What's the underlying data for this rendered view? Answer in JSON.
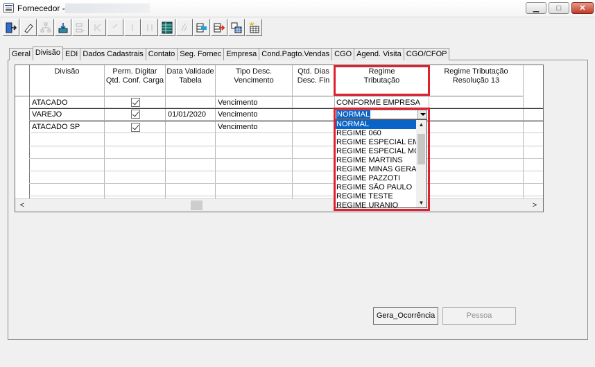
{
  "window": {
    "title": "Fornecedor -",
    "minimize_label": "▁",
    "maximize_label": "□",
    "close_label": "✕"
  },
  "toolbar": {
    "buttons": [
      "exit-icon",
      "edit-icon",
      "tree-icon",
      "save-download-icon",
      "cut-icon",
      "first-icon",
      "prev-icon",
      "next-icon",
      "last-icon",
      "grid-icon",
      "pencil-icon",
      "export-icon",
      "import-icon",
      "table-icon",
      "refresh-table-icon"
    ]
  },
  "tabs": [
    "Geral",
    "Divisão",
    "EDI",
    "Dados Cadastrais",
    "Contato",
    "Seg. Fornec",
    "Empresa",
    "Cond.Pagto.Vendas",
    "CGO",
    "Agend. Visita",
    "CGO/CFOP"
  ],
  "active_tab": "Divisão",
  "grid": {
    "headers": {
      "divisao": "Divisão",
      "perm_digitar_1": "Perm. Digitar",
      "perm_digitar_2": "Qtd. Conf. Carga",
      "data_validade_1": "Data Validade",
      "data_validade_2": "Tabela",
      "tipo_desc_1": "Tipo Desc.",
      "tipo_desc_2": "Vencimento",
      "qtd_dias_1": "Qtd. Dias",
      "qtd_dias_2": "Desc. Fin",
      "regime_1": "Regime",
      "regime_2": "Tributação",
      "regime_res_1": "Regime Tributação",
      "regime_res_2": "Resolução 13"
    },
    "rows": [
      {
        "divisao": "ATACADO",
        "perm": true,
        "data": "",
        "tipo": "Vencimento",
        "qtd": "",
        "regime": "CONFORME EMPRESA"
      },
      {
        "divisao": "VAREJO",
        "perm": true,
        "data": "01/01/2020",
        "tipo": "Vencimento",
        "qtd": "",
        "regime": "NORMAL"
      },
      {
        "divisao": "ATACADO SP",
        "perm": true,
        "data": "",
        "tipo": "Vencimento",
        "qtd": "",
        "regime": ""
      }
    ]
  },
  "regime_dropdown": {
    "selected": "NORMAL",
    "options": [
      "NORMAL",
      "REGIME 060",
      "REGIME ESPECIAL EM",
      "REGIME ESPECIAL MG",
      "REGIME MARTINS",
      "REGIME MINAS GERAI",
      "REGIME PAZZOTI",
      "REGIME SÃO PAULO",
      "REGIME TESTE",
      "REGIME URANIO"
    ]
  },
  "buttons": {
    "gera_ocorrencia": "Gera_Ocorrência",
    "pessoa": "Pessoa"
  },
  "colors": {
    "highlight": "#e0202e",
    "selection": "#0a64c8"
  }
}
